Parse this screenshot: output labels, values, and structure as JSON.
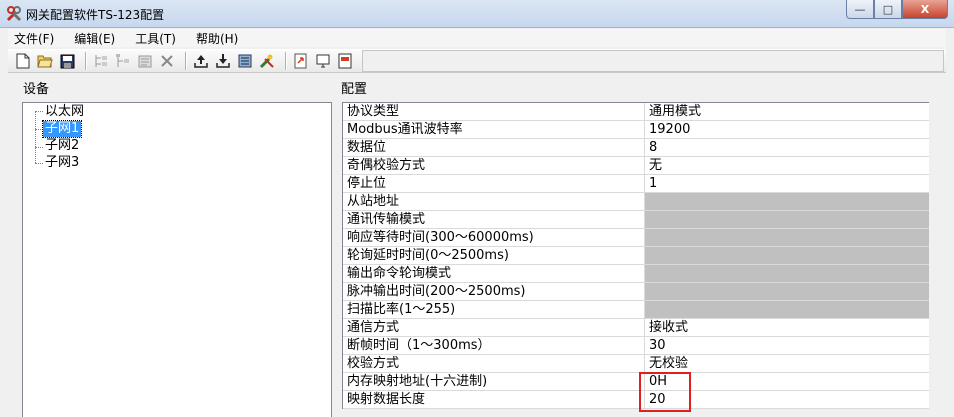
{
  "window": {
    "title": "网关配置软件TS-123配置",
    "minimize_label": "—",
    "maximize_label": "□",
    "close_label": "X"
  },
  "menu": [
    {
      "label": "文件(F)"
    },
    {
      "label": "编辑(E)"
    },
    {
      "label": "工具(T)"
    },
    {
      "label": "帮助(H)"
    }
  ],
  "toolbar_icons": [
    "new-file-icon",
    "open-folder-icon",
    "save-icon",
    "tree-add-icon",
    "tree-remove-icon",
    "properties-icon",
    "delete-icon",
    "upload-icon",
    "download-icon",
    "config-icon",
    "tools-icon",
    "export-icon",
    "monitor-icon",
    "doc-icon"
  ],
  "left_panel": {
    "title": "设备",
    "tree": [
      "以太网",
      "子网1",
      "子网2",
      "子网3"
    ],
    "selected_index": 1
  },
  "right_panel": {
    "title": "配置",
    "rows": [
      {
        "name": "协议类型",
        "value": "通用模式",
        "disabled": false
      },
      {
        "name": "Modbus通讯波特率",
        "value": "19200",
        "disabled": false
      },
      {
        "name": "数据位",
        "value": "8",
        "disabled": false
      },
      {
        "name": "奇偶校验方式",
        "value": "无",
        "disabled": false
      },
      {
        "name": "停止位",
        "value": "1",
        "disabled": false
      },
      {
        "name": "从站地址",
        "value": "",
        "disabled": true
      },
      {
        "name": "通讯传输模式",
        "value": "",
        "disabled": true
      },
      {
        "name": "响应等待时间(300～60000ms)",
        "value": "",
        "disabled": true
      },
      {
        "name": "轮询延时时间(0～2500ms)",
        "value": "",
        "disabled": true
      },
      {
        "name": "输出命令轮询模式",
        "value": "",
        "disabled": true
      },
      {
        "name": "脉冲输出时间(200～2500ms)",
        "value": "",
        "disabled": true
      },
      {
        "name": "扫描比率(1～255)",
        "value": "",
        "disabled": true
      },
      {
        "name": "通信方式",
        "value": "接收式",
        "disabled": false
      },
      {
        "name": "断帧时间（1～300ms）",
        "value": "30",
        "disabled": false
      },
      {
        "name": "校验方式",
        "value": "无校验",
        "disabled": false
      },
      {
        "name": "内存映射地址(十六进制)",
        "value": "0H",
        "disabled": false
      },
      {
        "name": "映射数据长度",
        "value": "20",
        "disabled": false
      }
    ]
  },
  "colors": {
    "selection": "#3399ff",
    "disabled_cell": "#c0c0c0",
    "highlight": "#e02020"
  }
}
